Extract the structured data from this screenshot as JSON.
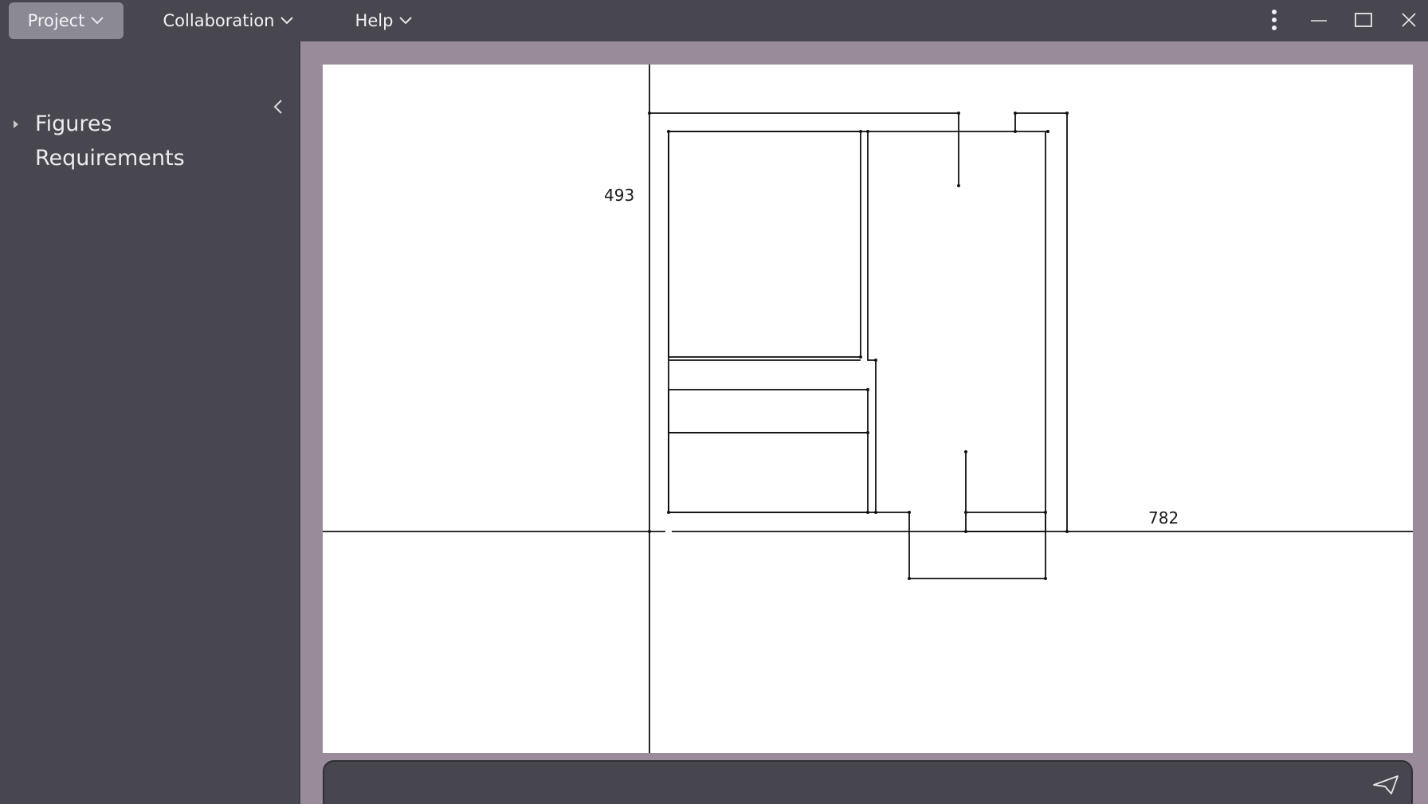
{
  "menubar": {
    "project_label": "Project",
    "collaboration_label": "Collaboration",
    "help_label": "Help"
  },
  "sidebar": {
    "items": [
      {
        "label": "Figures"
      },
      {
        "label": "Requirements"
      }
    ]
  },
  "canvas": {
    "y_label": "493",
    "x_label": "782"
  },
  "colors": {
    "chrome": "#48464f",
    "active_menu": "#8a8994",
    "workspace": "#998b9a",
    "canvas": "#ffffff",
    "stroke": "#111111"
  },
  "icons": [
    "chevron-down-icon",
    "kebab-icon",
    "minimize-icon",
    "maximize-icon",
    "close-icon",
    "chevron-left-icon",
    "caret-right-icon",
    "send-icon"
  ]
}
